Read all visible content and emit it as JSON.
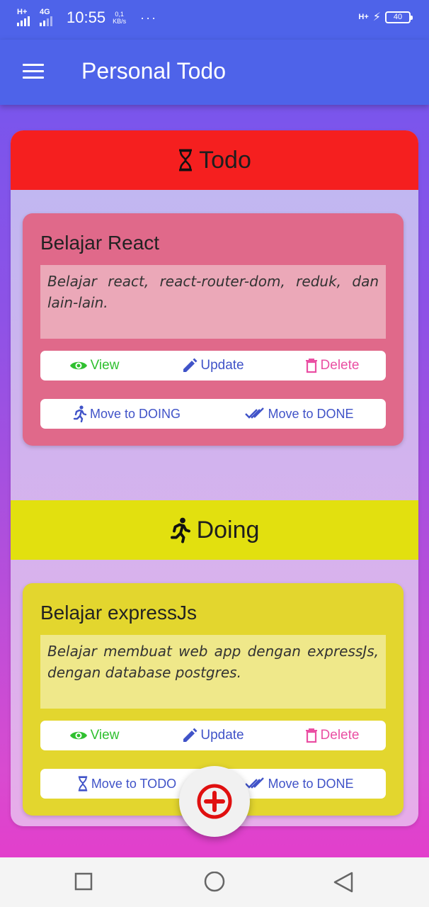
{
  "status_bar": {
    "net1": "H+",
    "net2": "4G",
    "time": "10:55",
    "speed_value": "0,1",
    "speed_unit": "KB/s",
    "more": "···",
    "net3": "H+",
    "battery": "40"
  },
  "app": {
    "title": "Personal Todo",
    "menu_icon": "hamburger-menu-icon"
  },
  "columns": {
    "todo": {
      "title": "Todo",
      "color": "#f51f1f",
      "icon": "hourglass-icon",
      "cards": [
        {
          "title": "Belajar React",
          "description": "Belajar react, react-router-dom, reduk, dan lain-lain.",
          "view": "View",
          "update": "Update",
          "delete": "Delete",
          "move_a": "Move to DOING",
          "move_b": "Move to DONE"
        }
      ]
    },
    "doing": {
      "title": "Doing",
      "color": "#e2e00f",
      "icon": "running-icon",
      "cards": [
        {
          "title": "Belajar expressJs",
          "description": "Belajar membuat web app dengan expressJs, dengan database postgres.",
          "view": "View",
          "update": "Update",
          "delete": "Delete",
          "move_a": "Move to TODO",
          "move_b": "Move to DONE"
        }
      ]
    }
  },
  "fab": {
    "icon": "add-circle-icon",
    "color": "#e01010"
  },
  "colors": {
    "app_bar": "#4e63e9",
    "view": "#2fc02f",
    "update": "#4053c8",
    "delete": "#ea4fa3"
  }
}
